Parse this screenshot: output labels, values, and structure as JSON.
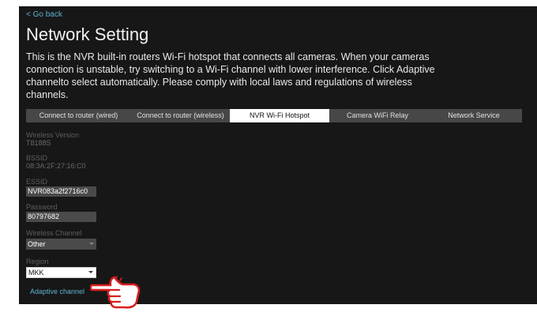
{
  "header": {
    "back_label": "< Go back",
    "title": "Network Setting",
    "description": "This is the NVR built-in routers Wi-Fi hotspot that connects all cameras. When your cameras connection is unstable, try switching to a Wi-Fi channel with lower interference. Click Adaptive channelto select automatically. Please comply with local laws and regulations of wireless channels."
  },
  "tabs": [
    {
      "label": "Connect to router (wired)",
      "active": false
    },
    {
      "label": "Connect to router (wireless)",
      "active": false
    },
    {
      "label": "NVR Wi-Fi Hotspot",
      "active": true
    },
    {
      "label": "Camera WiFi Relay",
      "active": false
    },
    {
      "label": "Network Service",
      "active": false
    }
  ],
  "fields": {
    "wireless_version": {
      "label": "Wireless Version",
      "value": "T8188S"
    },
    "bssid": {
      "label": "BSSID",
      "value": "08:3A:2F:27:16:C0"
    },
    "essid": {
      "label": "ESSID",
      "value": "NVR083a2f2716c0"
    },
    "password": {
      "label": "Password",
      "value": "80797682"
    },
    "wireless_channel": {
      "label": "Wireless Channel",
      "value": "Other"
    },
    "region": {
      "label": "Region",
      "value": "MKK"
    }
  },
  "adaptive_label": "Adaptive channel",
  "colors": {
    "background": "#171717",
    "accent_link": "#5fb3d0",
    "tab_bar": "#474747",
    "tab_active": "#ffffff",
    "annotation_hand": "#d81e1e"
  },
  "icons": {
    "pointer": "pointing-hand-icon"
  }
}
